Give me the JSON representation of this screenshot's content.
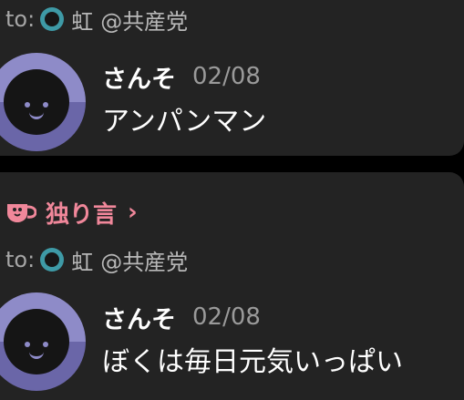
{
  "posts": [
    {
      "to_label": "to:",
      "target_name": "虹",
      "target_group": "@共産党",
      "author": "さんそ",
      "date": "02/08",
      "message": "アンパンマン"
    },
    {
      "context_label": "独り言",
      "context_chevron": "›",
      "to_label": "to:",
      "target_name": "虹",
      "target_group": "@共産党",
      "author": "さんそ",
      "date": "02/08",
      "message": "ぼくは毎日元気いっぱい"
    }
  ],
  "colors": {
    "background": "#000000",
    "card": "#232323",
    "accent_pink": "#f0879a",
    "avatar_top": "#8e8bc8",
    "avatar_bottom": "#6a66a8",
    "mini_avatar": "#3e9aa6"
  },
  "icons": {
    "context": "cup-icon",
    "recipient": "mini-avatar-icon"
  }
}
